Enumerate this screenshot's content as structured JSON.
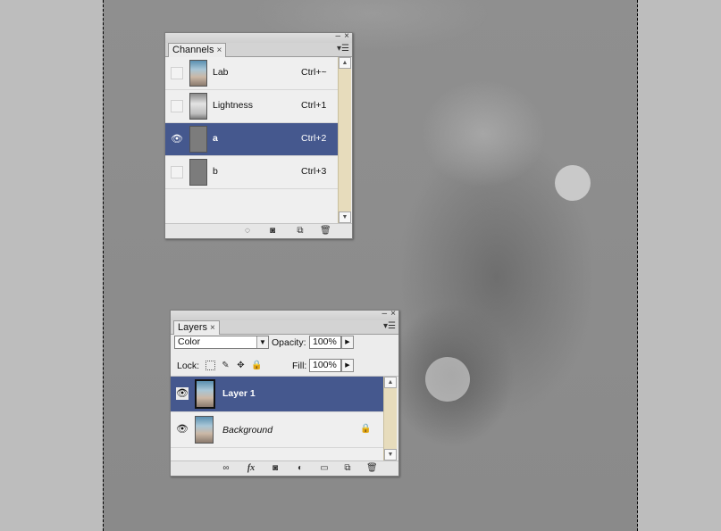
{
  "channels_panel": {
    "tab_label": "Channels",
    "tab_close": "×",
    "minimize": "–",
    "close": "×",
    "menu": "▾☰",
    "rows": [
      {
        "name": "Lab",
        "shortcut": "Ctrl+~",
        "visible": false,
        "selected": false
      },
      {
        "name": "Lightness",
        "shortcut": "Ctrl+1",
        "visible": false,
        "selected": false
      },
      {
        "name": "a",
        "shortcut": "Ctrl+2",
        "visible": true,
        "selected": true
      },
      {
        "name": "b",
        "shortcut": "Ctrl+3",
        "visible": false,
        "selected": false
      }
    ],
    "footer_icons": [
      "load-selection-icon",
      "save-selection-icon",
      "new-channel-icon",
      "delete-channel-icon"
    ]
  },
  "layers_panel": {
    "tab_label": "Layers",
    "tab_close": "×",
    "minimize": "–",
    "close": "×",
    "menu": "▾☰",
    "blend_mode": "Color",
    "opacity_label": "Opacity:",
    "opacity_value": "100%",
    "lock_label": "Lock:",
    "fill_label": "Fill:",
    "fill_value": "100%",
    "layers": [
      {
        "name": "Layer 1",
        "visible": true,
        "selected": true,
        "locked": false
      },
      {
        "name": "Background",
        "visible": true,
        "selected": false,
        "locked": true
      }
    ],
    "footer_icons": [
      "link-layers-icon",
      "fx-icon",
      "add-mask-icon",
      "adjustment-layer-icon",
      "group-folder-icon",
      "new-layer-icon",
      "delete-layer-icon"
    ]
  },
  "colors": {
    "selection": "#45588e",
    "scrollbar": "#e7dcbc",
    "workspace": "#bdbdbd"
  }
}
